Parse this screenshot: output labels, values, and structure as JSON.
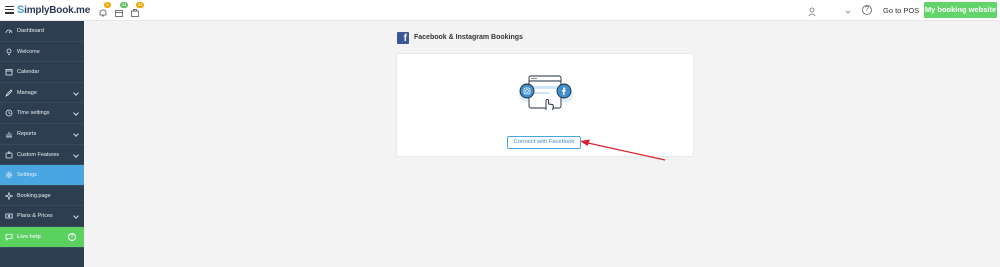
{
  "brand": {
    "logo_text": "implyBook.me",
    "logo_letter": "S"
  },
  "topbar": {
    "badges": [
      {
        "icon": "bell-icon",
        "count": "0",
        "color": "#f0a500"
      },
      {
        "icon": "calendar-icon",
        "count": "21",
        "color": "#63c066"
      },
      {
        "icon": "briefcase-icon",
        "count": "43",
        "color": "#f0a500"
      }
    ],
    "help_label": "?",
    "pos_label": "Go to POS",
    "booking_website_label": "My booking website"
  },
  "sidebar": {
    "items": [
      {
        "label": "Dashboard",
        "icon": "dashboard-icon",
        "has_chevron": false
      },
      {
        "label": "Welcome",
        "icon": "bulb-icon",
        "has_chevron": false
      },
      {
        "label": "Calendar",
        "icon": "calendar-icon",
        "has_chevron": false
      },
      {
        "label": "Manage",
        "icon": "pencil-icon",
        "has_chevron": true
      },
      {
        "label": "Time settings",
        "icon": "clock-icon",
        "has_chevron": true
      },
      {
        "label": "Reports",
        "icon": "chart-icon",
        "has_chevron": true
      },
      {
        "label": "Custom Features",
        "icon": "puzzle-icon",
        "has_chevron": true
      },
      {
        "label": "Settings",
        "icon": "gear-icon",
        "has_chevron": false,
        "active": true
      },
      {
        "label": "Booking.page",
        "icon": "sparkle-icon",
        "has_chevron": false
      },
      {
        "label": "Plans & Prices",
        "icon": "ticket-icon",
        "has_chevron": true
      }
    ],
    "live_help": {
      "label": "Live help",
      "icon": "chat-icon",
      "help": "?"
    }
  },
  "main": {
    "title": "Facebook & Instagram Bookings",
    "connect_button": "Connect with Facebook"
  },
  "colors": {
    "sidebar_bg": "#2d3e50",
    "active_item": "#4aa6e0",
    "live_help": "#5bd15f",
    "brand_green": "#63d46a",
    "facebook_blue": "#3b5998",
    "annotation_arrow": "#d8222b"
  }
}
